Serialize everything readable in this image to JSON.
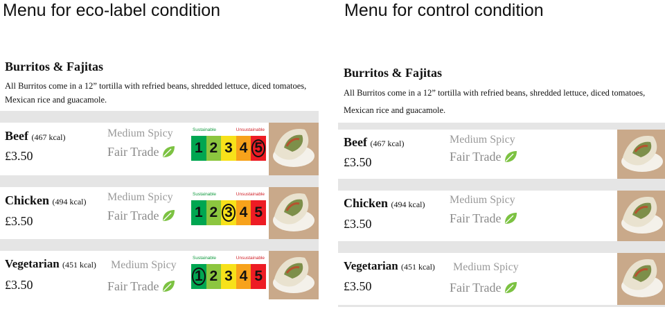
{
  "headings": {
    "left": "Menu for eco-label condition",
    "right": "Menu for control condition"
  },
  "menu": {
    "title": "Burritos & Fajitas",
    "description": "All Burritos come in a 12” tortilla with refried beans, shredded lettuce, diced tomatoes, Mexican rice and guacamole."
  },
  "items": [
    {
      "name": "Beef",
      "kcal": "(467 kcal)",
      "price": "£3.50",
      "spice": "Medium Spicy",
      "fair_trade": "Fair Trade",
      "eco_score": 5
    },
    {
      "name": "Chicken",
      "kcal": "(494 kcal)",
      "price": "£3.50",
      "spice": "Medium Spicy",
      "fair_trade": "Fair Trade",
      "eco_score": 3
    },
    {
      "name": "Vegetarian",
      "kcal": "(451 kcal)",
      "price": "£3.50",
      "spice": "Medium Spicy",
      "fair_trade": "Fair Trade",
      "eco_score": 1
    }
  ],
  "eco_label": {
    "sustainable_label": "Sustainable",
    "unsustainable_label": "Unsustainable",
    "scale": [
      "1",
      "2",
      "3",
      "4",
      "5"
    ],
    "colors": [
      "#00a651",
      "#8cc63f",
      "#f7e11a",
      "#f7a21b",
      "#ed1c24"
    ]
  },
  "colors": {
    "band": "#e5e5e5",
    "leaf": "#7cc242",
    "thumb": "#c9a98a"
  }
}
